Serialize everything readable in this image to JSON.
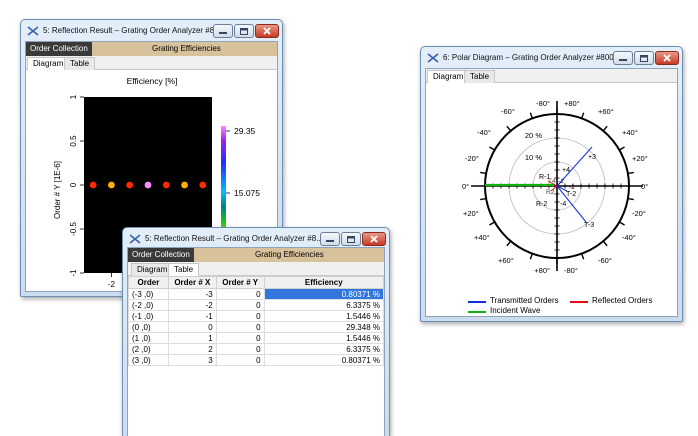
{
  "window_reflection_diagram": {
    "title": "5: Reflection Result – Grating Order Analyzer #8...",
    "collection_tab": "Order Collection",
    "section_label": "Grating Efficiencies",
    "tabs": [
      "Diagram",
      "Table"
    ],
    "plot_title": "Efficiency  [%]",
    "y_axis_label": "Order # Y [1E-6]",
    "y_ticks": [
      "1",
      "0.5",
      "0",
      "-0.5",
      "-1"
    ],
    "x_ticks": [
      "-2"
    ],
    "colorbar_ticks": [
      "29.35",
      "15.075"
    ]
  },
  "window_reflection_table": {
    "title": "5: Reflection Result – Grating Order Analyzer #8...",
    "collection_tab": "Order Collection",
    "section_label": "Grating Efficiencies",
    "tabs": [
      "Diagram",
      "Table"
    ],
    "columns": [
      "Order",
      "Order # X",
      "Order # Y",
      "Efficiency"
    ],
    "rows": [
      [
        "(-3 ,0)",
        "-3",
        "0",
        "0.80371 %"
      ],
      [
        "(-2 ,0)",
        "-2",
        "0",
        "6.3375 %"
      ],
      [
        "(-1 ,0)",
        "-1",
        "0",
        "1.5446 %"
      ],
      [
        "(0 ,0)",
        "0",
        "0",
        "29.348 %"
      ],
      [
        "(1 ,0)",
        "1",
        "0",
        "1.5446 %"
      ],
      [
        "(2 ,0)",
        "2",
        "0",
        "6.3375 %"
      ],
      [
        "(3 ,0)",
        "3",
        "0",
        "0.80371 %"
      ]
    ],
    "selected_row": 0
  },
  "window_polar": {
    "title": "6: Polar Diagram – Grating Order Analyzer #800",
    "tabs": [
      "Diagram",
      "Table"
    ],
    "radial_labels": [
      "20 %",
      "10 %"
    ],
    "angle_labels": {
      "top_left": "-80°",
      "top_right": "+80°",
      "bottom_left": "+80°",
      "bottom_right": "-80°",
      "left": [
        "-60°",
        "-40°",
        "-20°",
        "0°",
        "+20°",
        "+40°",
        "+60°"
      ],
      "right": [
        "+60°",
        "+40°",
        "+20°",
        "0°",
        "-20°",
        "-40°",
        "-60°"
      ]
    },
    "order_labels": [
      "+4",
      "+3",
      "T4",
      "T-2",
      "T-3",
      "-4",
      "R-2",
      "R-1",
      "R2",
      "-1",
      "-2"
    ],
    "legend": {
      "transmitted": "Transmitted Orders",
      "reflected": "Reflected Orders",
      "incident": "Incident Wave"
    },
    "colors": {
      "transmitted": "#1030e0",
      "reflected": "#e01010",
      "incident": "#10b010"
    }
  },
  "chart_data": [
    {
      "type": "scatter",
      "title": "Efficiency  [%]",
      "ylabel": "Order # Y [1E-6]",
      "x": [
        -3,
        -2,
        -1,
        0,
        1,
        2,
        3
      ],
      "y": [
        0,
        0,
        0,
        0,
        0,
        0,
        0
      ],
      "values": [
        0.80371,
        6.3375,
        1.5446,
        29.348,
        1.5446,
        6.3375,
        0.80371
      ],
      "ylim": [
        -1,
        1
      ],
      "colorbar_range": [
        0.80371,
        29.35
      ]
    }
  ]
}
